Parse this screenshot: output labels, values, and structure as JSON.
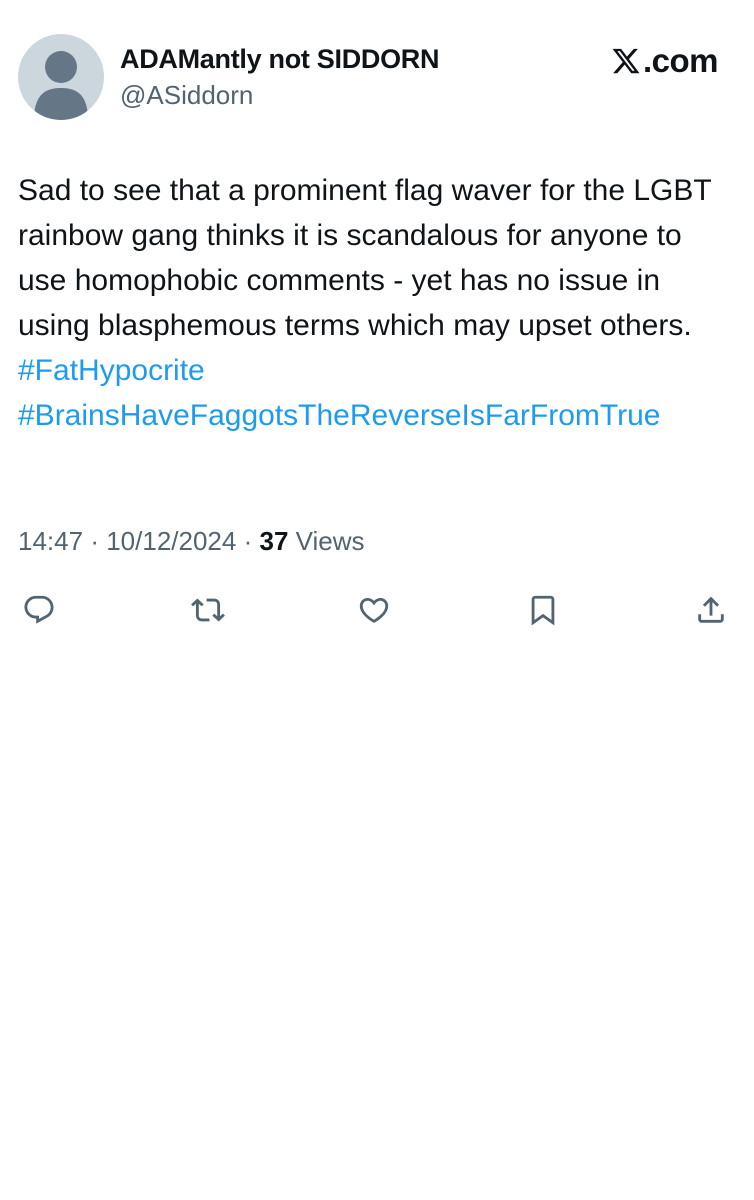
{
  "brand": {
    "text": ".com"
  },
  "author": {
    "display_name": "ADAMantly not SIDDORN",
    "handle": "@ASiddorn"
  },
  "post": {
    "text": "Sad to see that a prominent flag waver for the LGBT rainbow gang thinks it is scandalous for anyone to use homophobic comments - yet has no issue in using blasphemous terms which may upset others.",
    "hashtags": [
      "#FatHypocrite",
      "#BrainsHaveFaggotsTheReverseIsFarFromTrue"
    ]
  },
  "meta": {
    "time": "14:47",
    "separator": "·",
    "date": "10/12/2024",
    "views_count": "37",
    "views_label": "Views"
  },
  "actions": [
    {
      "icon": "reply-icon"
    },
    {
      "icon": "repost-icon"
    },
    {
      "icon": "like-icon"
    },
    {
      "icon": "bookmark-icon"
    },
    {
      "icon": "share-icon"
    }
  ],
  "colors": {
    "text": "#0f1419",
    "secondary": "#536471",
    "link": "#1d9bf0",
    "avatar_bg": "#ccd6dd",
    "avatar_fg": "#657786"
  }
}
